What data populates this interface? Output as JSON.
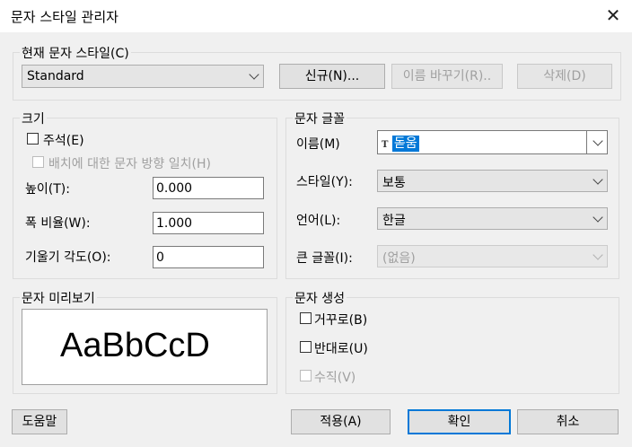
{
  "window": {
    "title": "문자 스타일 관리자",
    "close_glyph": "✕"
  },
  "current_style": {
    "legend": "현재 문자 스타일(C)",
    "selected": "Standard",
    "new_button": "신규(N)...",
    "rename_button": "이름 바꾸기(R)..",
    "delete_button": "삭제(D)"
  },
  "size": {
    "legend": "크기",
    "annotative_label": "주석(E)",
    "match_orientation_label": "배치에 대한 문자 방향 일치(H)",
    "height_label": "높이(T):",
    "height_value": "0.000",
    "width_factor_label": "폭 비율(W):",
    "width_factor_value": "1.000",
    "oblique_label": "기울기 각도(O):",
    "oblique_value": "0"
  },
  "font": {
    "legend": "문자 글꼴",
    "name_label": "이름(M)",
    "name_value": "돋움",
    "font_type_glyph": "T",
    "style_label": "스타일(Y):",
    "style_value": "보통",
    "language_label": "언어(L):",
    "language_value": "한글",
    "big_font_label": "큰 글꼴(I):",
    "big_font_value": "(없음)"
  },
  "preview": {
    "legend": "문자 미리보기",
    "sample": "AaBbCcD"
  },
  "effects": {
    "legend": "문자 생성",
    "upside_down_label": "거꾸로(B)",
    "backwards_label": "반대로(U)",
    "vertical_label": "수직(V)"
  },
  "footer": {
    "help_button": "도움말",
    "apply_button": "적용(A)",
    "ok_button": "확인",
    "cancel_button": "취소"
  }
}
